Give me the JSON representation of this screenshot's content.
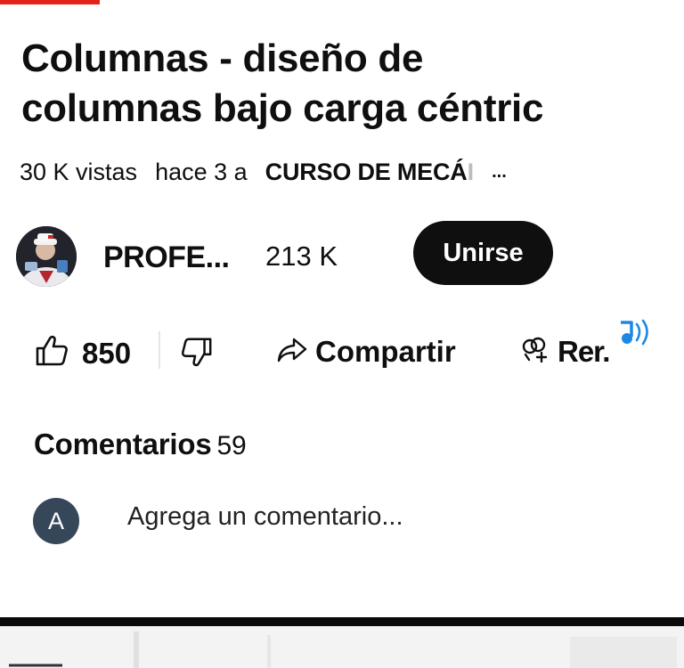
{
  "video": {
    "title_line1": "Columnas - diseño de",
    "title_line2": "columnas bajo carga céntric",
    "views": "30 K vistas",
    "age": "hace 3 a",
    "playlist": "CURSO DE MECÁ",
    "playlist_fade": "I",
    "more": "..."
  },
  "channel": {
    "name": "PROFE...",
    "subscribers": "213 K",
    "join_label": "Unirse"
  },
  "actions": {
    "like_count": "850",
    "share_label": "Compartir",
    "remix_label": "Rer."
  },
  "comments": {
    "heading": "Comentarios",
    "count": "59",
    "avatar_letter": "A",
    "placeholder": "Agrega un comentario..."
  },
  "colors": {
    "progress": "#e62117",
    "join_bg": "#0f0f0f",
    "comment_avatar": "#36475a",
    "sound_icon": "#1e88e5"
  }
}
